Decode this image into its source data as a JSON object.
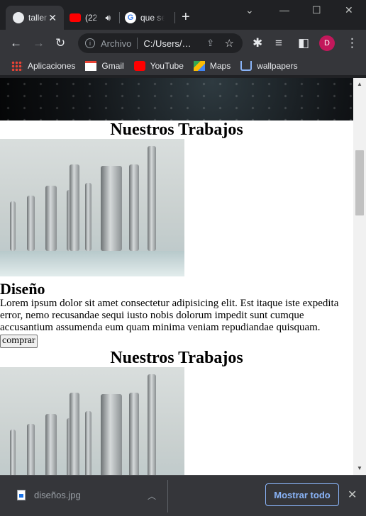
{
  "tabs": [
    {
      "title": "taller",
      "favicon": "globe-icon",
      "active": true
    },
    {
      "title": "(22",
      "favicon": "youtube-icon",
      "audio": true
    },
    {
      "title": "que se",
      "favicon": "google-icon"
    }
  ],
  "window_controls": {
    "minimize": "—",
    "maximize": "☐",
    "close": "✕",
    "tab_search": "⌄"
  },
  "toolbar": {
    "omnibox_label": "Archivo",
    "url": "C:/Users/…",
    "avatar_letter": "D"
  },
  "bookmarks": [
    {
      "label": "Aplicaciones",
      "icon": "apps-grid-icon"
    },
    {
      "label": "Gmail",
      "icon": "gmail-icon"
    },
    {
      "label": "YouTube",
      "icon": "youtube-icon"
    },
    {
      "label": "Maps",
      "icon": "maps-icon"
    },
    {
      "label": "wallpapers",
      "icon": "wallpapers-icon"
    }
  ],
  "page": {
    "sections": [
      {
        "heading": "Nuestros Trabajos",
        "item_title": "Diseño",
        "item_desc": "Lorem ipsum dolor sit amet consectetur adipisicing elit. Est itaque iste expedita error, nemo recusandae sequi iusto nobis dolorum impedit sunt cumque accusantium assumenda eum quam minima veniam repudiandae quisquam.",
        "button": "comprar"
      },
      {
        "heading": "Nuestros Trabajos"
      }
    ]
  },
  "downloads": {
    "file": "diseños.jpg",
    "show_all": "Mostrar todo"
  },
  "colors": {
    "chrome_dark": "#202124",
    "toolbar": "#35363a",
    "accent": "#8ab4f8",
    "avatar": "#c2185b"
  }
}
